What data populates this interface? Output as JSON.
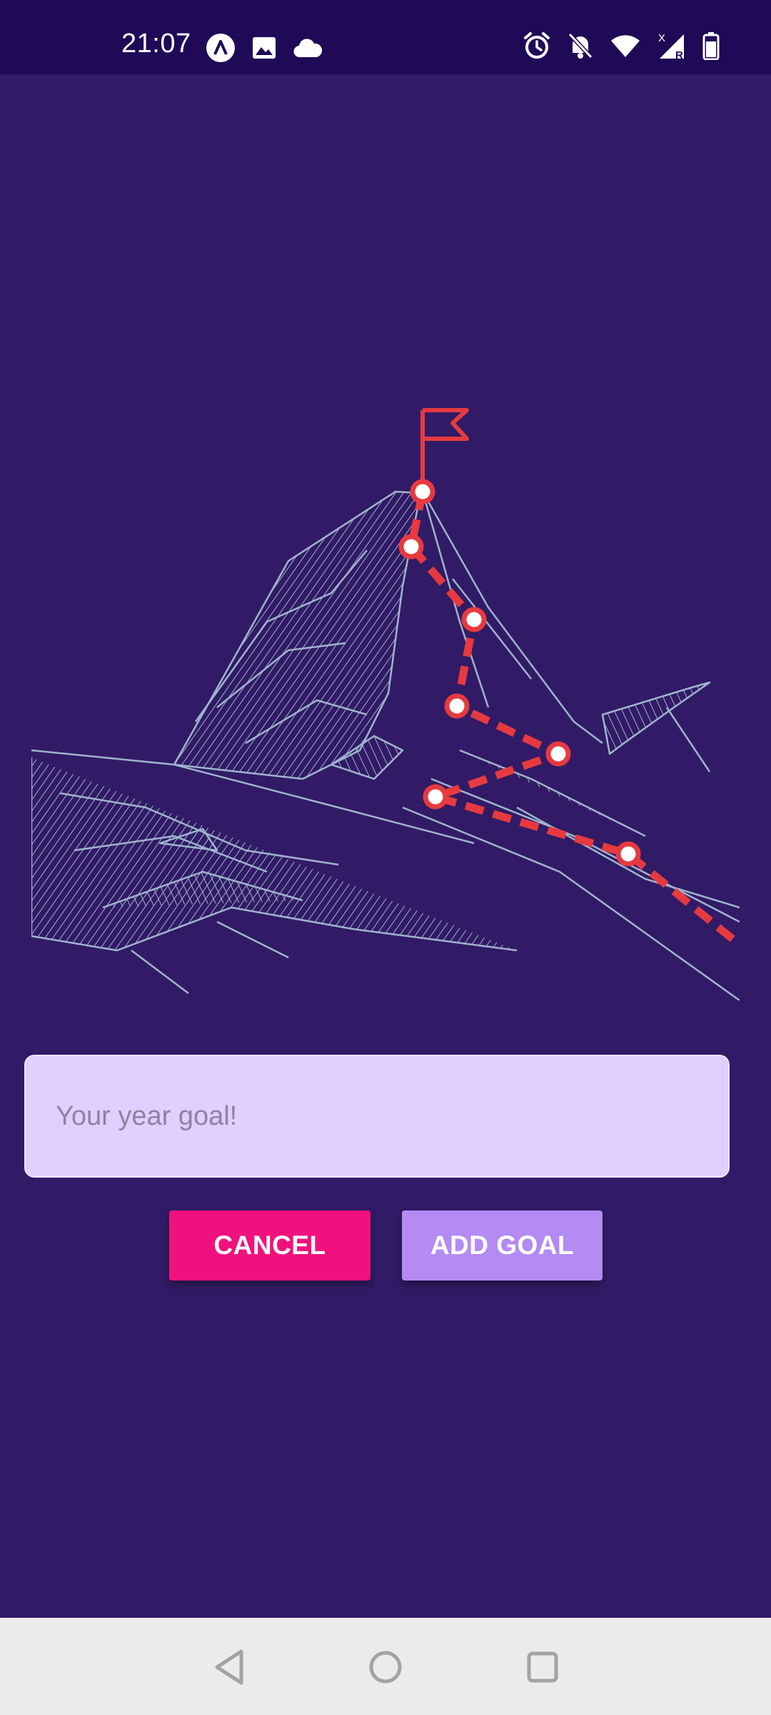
{
  "status_bar": {
    "time": "21:07",
    "left_icons": [
      "app-notification-icon",
      "image-icon",
      "cloud-icon"
    ],
    "right_icons": [
      "alarm-icon",
      "notifications-off-icon",
      "wifi-icon",
      "signal-icon",
      "battery-icon"
    ],
    "signal_marks": {
      "top": "X",
      "bottom": "R"
    }
  },
  "illustration": {
    "name": "mountain-summit-illustration",
    "colors": {
      "mountain": "#9fb4cc",
      "path": "#e63a3f",
      "flag": "#e63a3f"
    }
  },
  "form": {
    "goal_placeholder": "Your year goal!",
    "goal_value": ""
  },
  "actions": {
    "cancel_label": "CANCEL",
    "add_label": "ADD GOAL",
    "cancel_color": "#f1117e",
    "add_color": "#b48af3"
  },
  "nav_bar": {
    "icons": [
      "back-icon",
      "home-icon",
      "recent-apps-icon"
    ]
  }
}
